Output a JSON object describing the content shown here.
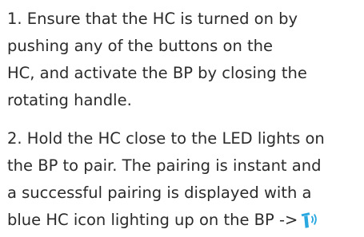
{
  "instructions": {
    "step1": {
      "lines": [
        "1. Ensure that the HC is turned on by",
        "pushing any of the buttons on the",
        "HC, and activate the BP by closing the",
        "rotating handle."
      ]
    },
    "step2": {
      "lines": [
        "2. Hold the HC close to the LED lights on",
        "the BP to pair. The pairing is instant and",
        "a successful pairing is displayed with a",
        "blue HC icon lighting up on the BP ->"
      ],
      "icon": {
        "name": "hc-pairing-icon",
        "color": "#29a8e0"
      }
    }
  }
}
